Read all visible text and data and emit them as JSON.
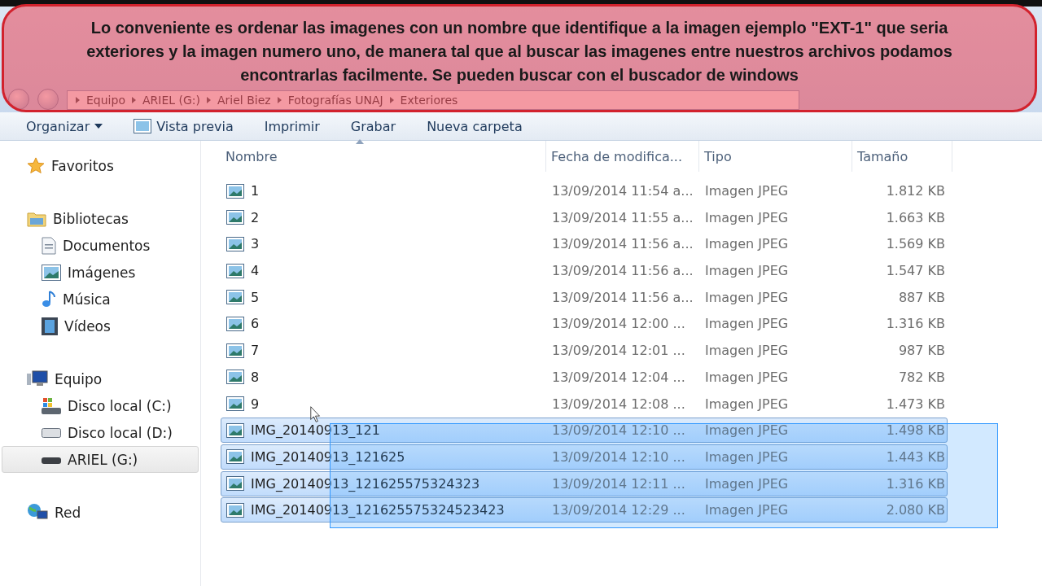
{
  "annotation": {
    "text": "Lo conveniente es ordenar las imagenes con un nombre que identifique a la imagen ejemplo \"EXT-1\" que seria exteriores y la imagen numero uno, de manera tal que al buscar las imagenes entre nuestros archivos podamos encontrarlas facilmente. Se pueden buscar con el buscador de windows"
  },
  "address_bar": {
    "breadcrumbs": [
      "Equipo",
      "ARIEL (G:)",
      "Ariel Biez",
      "Fotografías UNAJ",
      "Exteriores"
    ]
  },
  "toolbar": [
    {
      "label": "Organizar",
      "kind": "menu"
    },
    {
      "label": "Vista previa",
      "kind": "preview"
    },
    {
      "label": "Imprimir",
      "kind": "plain"
    },
    {
      "label": "Grabar",
      "kind": "plain"
    },
    {
      "label": "Nueva carpeta",
      "kind": "plain"
    }
  ],
  "sidebar": {
    "groups": [
      {
        "label": "Favoritos",
        "kind": "star",
        "selected": false
      },
      {
        "label": "Bibliotecas",
        "kind": "library",
        "selected": false,
        "children": [
          {
            "label": "Documentos",
            "kind": "document",
            "selected": false
          },
          {
            "label": "Imágenes",
            "kind": "image",
            "selected": false
          },
          {
            "label": "Música",
            "kind": "music",
            "selected": false
          },
          {
            "label": "Vídeos",
            "kind": "video",
            "selected": false
          }
        ]
      },
      {
        "label": "Equipo",
        "kind": "computer",
        "selected": false,
        "children": [
          {
            "label": "Disco local (C:)",
            "kind": "system-drive",
            "selected": false
          },
          {
            "label": "Disco local (D:)",
            "kind": "drive",
            "selected": false
          },
          {
            "label": "ARIEL (G:)",
            "kind": "usb",
            "selected": true
          }
        ]
      },
      {
        "label": "Red",
        "kind": "network",
        "selected": false
      }
    ]
  },
  "table": {
    "columns": [
      "Nombre",
      "Fecha de modifica...",
      "Tipo",
      "Tamaño"
    ],
    "rows": [
      {
        "name": "1",
        "date": "13/09/2014 11:54 a...",
        "type": "Imagen JPEG",
        "size": "1.812 KB",
        "selected": false
      },
      {
        "name": "2",
        "date": "13/09/2014 11:55 a...",
        "type": "Imagen JPEG",
        "size": "1.663 KB",
        "selected": false
      },
      {
        "name": "3",
        "date": "13/09/2014 11:56 a...",
        "type": "Imagen JPEG",
        "size": "1.569 KB",
        "selected": false
      },
      {
        "name": "4",
        "date": "13/09/2014 11:56 a...",
        "type": "Imagen JPEG",
        "size": "1.547 KB",
        "selected": false
      },
      {
        "name": "5",
        "date": "13/09/2014 11:56 a...",
        "type": "Imagen JPEG",
        "size": "887 KB",
        "selected": false
      },
      {
        "name": "6",
        "date": "13/09/2014 12:00 ...",
        "type": "Imagen JPEG",
        "size": "1.316 KB",
        "selected": false
      },
      {
        "name": "7",
        "date": "13/09/2014 12:01 ...",
        "type": "Imagen JPEG",
        "size": "987 KB",
        "selected": false
      },
      {
        "name": "8",
        "date": "13/09/2014 12:04 ...",
        "type": "Imagen JPEG",
        "size": "782 KB",
        "selected": false
      },
      {
        "name": "9",
        "date": "13/09/2014 12:08 ...",
        "type": "Imagen JPEG",
        "size": "1.473 KB",
        "selected": false
      },
      {
        "name": "IMG_20140913_121",
        "date": "13/09/2014 12:10 ...",
        "type": "Imagen JPEG",
        "size": "1.498 KB",
        "selected": true
      },
      {
        "name": "IMG_20140913_121625",
        "date": "13/09/2014 12:10 ...",
        "type": "Imagen JPEG",
        "size": "1.443 KB",
        "selected": true
      },
      {
        "name": "IMG_20140913_121625575324323",
        "date": "13/09/2014 12:11 ...",
        "type": "Imagen JPEG",
        "size": "1.316 KB",
        "selected": true
      },
      {
        "name": "IMG_20140913_121625575324523423",
        "date": "13/09/2014 12:29 ...",
        "type": "Imagen JPEG",
        "size": "2.080 KB",
        "selected": true
      }
    ]
  }
}
